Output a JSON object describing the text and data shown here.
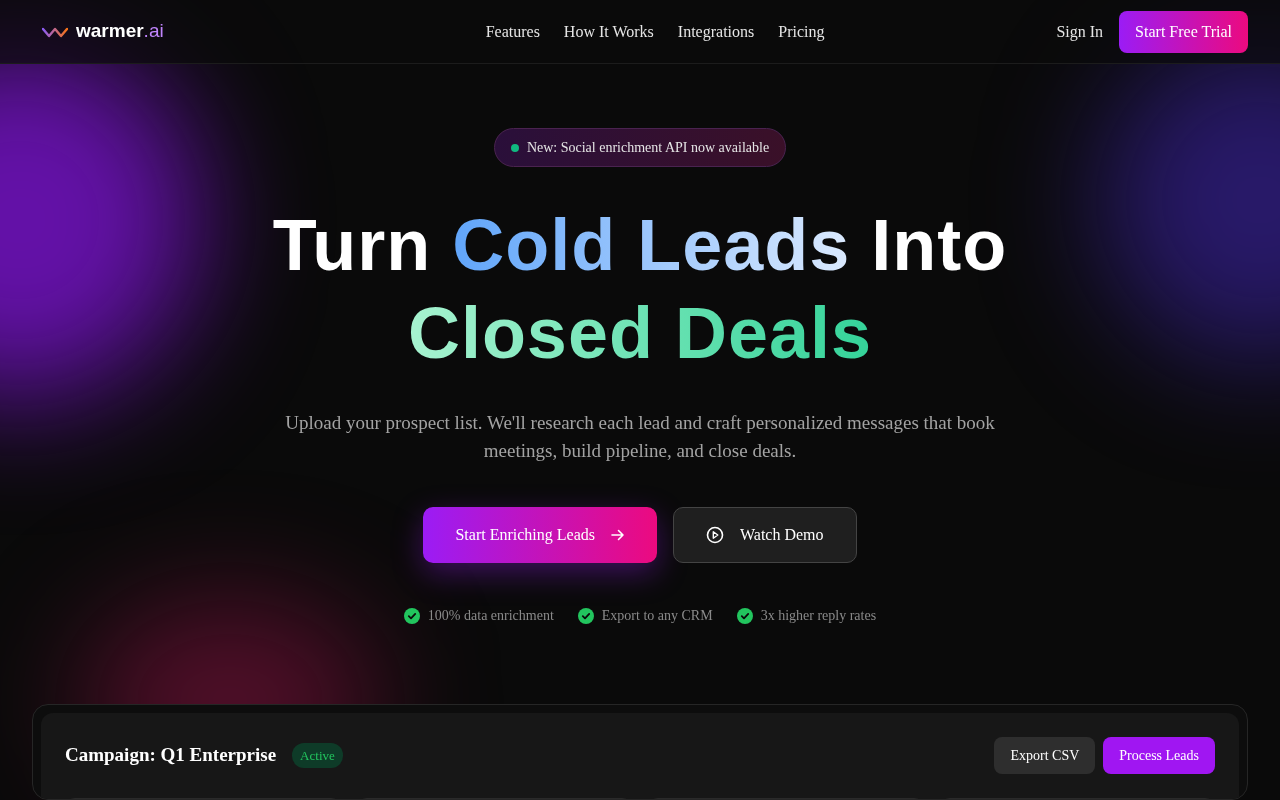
{
  "brand": {
    "name": "warmer",
    "suffix": ".ai"
  },
  "nav": {
    "links": [
      "Features",
      "How It Works",
      "Integrations",
      "Pricing"
    ],
    "sign_in": "Sign In",
    "cta": "Start Free Trial"
  },
  "announcement": {
    "text": "New: Social enrichment API now available",
    "color": "#10b981"
  },
  "headline": {
    "lines": [
      [
        {
          "text": "Turn ",
          "kind": "plain"
        },
        {
          "text": "Cold Leads",
          "kind": "blue"
        },
        {
          "text": " Into",
          "kind": "plain"
        }
      ],
      [
        {
          "text": "Closed Deals",
          "kind": "green"
        }
      ]
    ]
  },
  "subtitle": "Upload your prospect list. We'll research each lead and craft personalized messages that book meetings, build pipeline, and close deals.",
  "buttons": [
    {
      "label": "Start Enriching Leads",
      "kind": "primary"
    },
    {
      "label": "Watch Demo",
      "kind": "secondary"
    }
  ],
  "features": [
    "100% data enrichment",
    "Export to any CRM",
    "3x higher reply rates"
  ],
  "campaign": {
    "title": "Campaign: Q1 Enterprise",
    "status": "Active",
    "actions": [
      {
        "label": "Export CSV",
        "kind": "secondary"
      },
      {
        "label": "Process Leads",
        "kind": "primary"
      }
    ]
  }
}
